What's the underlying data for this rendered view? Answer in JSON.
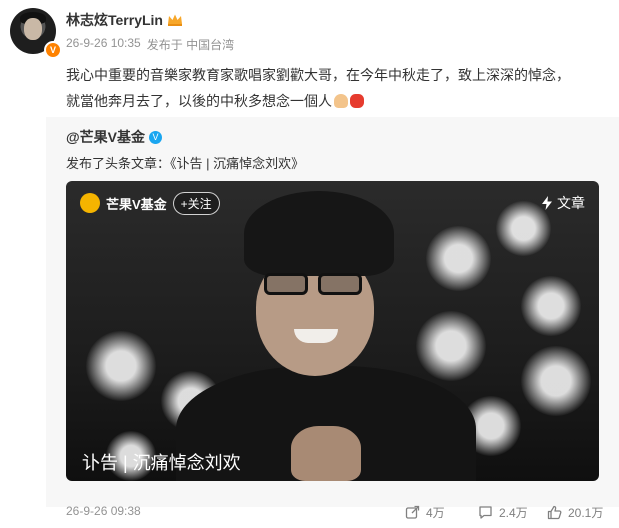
{
  "post": {
    "author": "林志炫TerryLin",
    "time": "26-9-26 10:35",
    "source": "发布于 中国台湾",
    "text_line1": "我心中重要的音樂家教育家歌唱家劉歡大哥，在今年中秋走了，致上深深的悼念，",
    "text_line2": "就當他奔月去了，以後的中秋多想念一個人"
  },
  "repost": {
    "account": "@芒果V基金",
    "action": "发布了头条文章：",
    "article_link": "《讣告 | 沉痛悼念刘欢》",
    "card": {
      "brand": "芒果V基金",
      "follow_label": "+关注",
      "type_label": "文章",
      "title": "讣告 | 沉痛悼念刘欢"
    },
    "time": "26-9-26 09:38",
    "repost_count": "4万",
    "comment_count": "2.4万",
    "like_count": "20.1万"
  },
  "icons": {
    "badge": "verified-orange-icon",
    "crown": "crown-icon",
    "repost": "repost-icon",
    "comment": "comment-icon",
    "like": "like-icon",
    "article": "lightning-icon"
  },
  "colors": {
    "accent_orange": "#ff8200",
    "verified_blue": "#1aa6f0",
    "muted": "#939393"
  }
}
